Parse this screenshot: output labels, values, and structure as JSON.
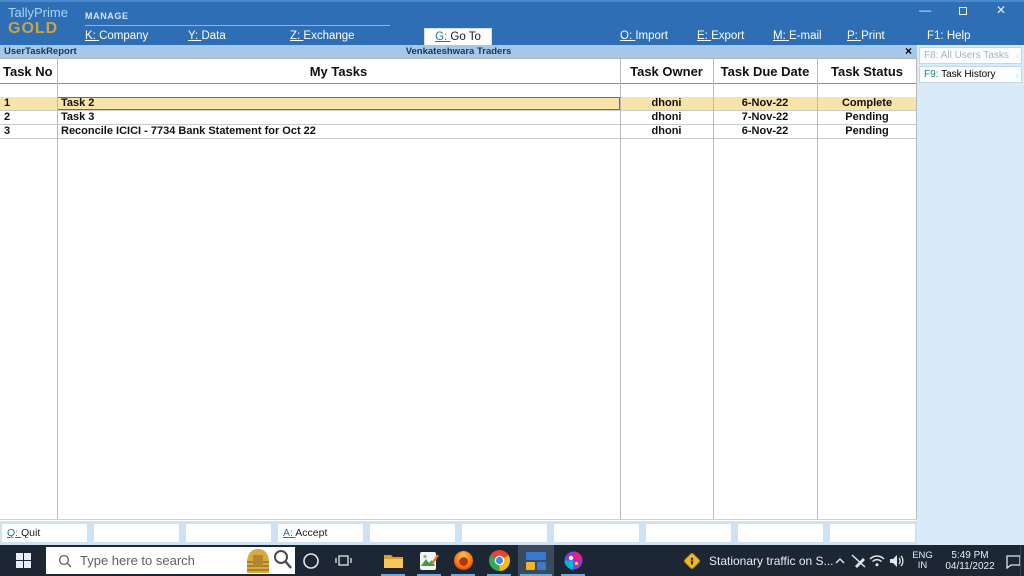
{
  "titlebar": {
    "brand_line1": "TallyPrime",
    "brand_line2": "GOLD",
    "manage_label": "MANAGE",
    "left_menu": [
      {
        "key": "K",
        "label": "Company"
      },
      {
        "key": "Y",
        "label": "Data"
      },
      {
        "key": "Z",
        "label": "Exchange"
      }
    ],
    "goto": {
      "key": "G",
      "label": "Go To"
    },
    "right_menu": [
      {
        "key": "O",
        "label": "Import"
      },
      {
        "key": "E",
        "label": "Export"
      },
      {
        "key": "M",
        "label": "E-mail"
      },
      {
        "key": "P",
        "label": "Print"
      },
      {
        "key": "F1",
        "label": "Help"
      }
    ]
  },
  "subbar": {
    "report_title": "UserTaskReport",
    "company_name": "Venkateshwara Traders",
    "close_glyph": "×"
  },
  "sidebar": {
    "items": [
      {
        "key": "F8",
        "label": "All Users Tasks",
        "enabled": false
      },
      {
        "key": "F9",
        "label": "Task History",
        "enabled": true
      }
    ],
    "arrow_glyph": "‹"
  },
  "table": {
    "columns": {
      "no": "Task No",
      "task": "My Tasks",
      "owner": "Task Owner",
      "due": "Task Due Date",
      "status": "Task Status"
    },
    "rows": [
      {
        "no": "1",
        "task": "Task 2",
        "owner": "dhoni",
        "due": "6-Nov-22",
        "status": "Complete",
        "selected": true
      },
      {
        "no": "2",
        "task": "Task 3",
        "owner": "dhoni",
        "due": "7-Nov-22",
        "status": "Pending",
        "selected": false
      },
      {
        "no": "3",
        "task": "Reconcile ICICI - 7734 Bank Statement for Oct 22",
        "owner": "dhoni",
        "due": "6-Nov-22",
        "status": "Pending",
        "selected": false
      }
    ]
  },
  "bottombar": {
    "quit": {
      "key": "Q",
      "label": "Quit"
    },
    "accept": {
      "key": "A",
      "label": "Accept"
    }
  },
  "taskbar": {
    "search_placeholder": "Type here to search",
    "notification_text": "Stationary traffic on S...",
    "tray": {
      "lang_line1": "ENG",
      "lang_line2": "IN",
      "time": "5:49 PM",
      "date": "04/11/2022"
    }
  },
  "colors": {
    "titlebar_blue": "#2e6eb5",
    "subbar_blue": "#a6c8e8",
    "sidebar_blue": "#d9eaf8",
    "bottombar_blue": "#cfe2f3",
    "accent_teal": "#1e7b8d",
    "brand_gold": "#c9a43f",
    "row_highlight": "#f8e3ab",
    "taskbar_dark": "#1c2733"
  }
}
